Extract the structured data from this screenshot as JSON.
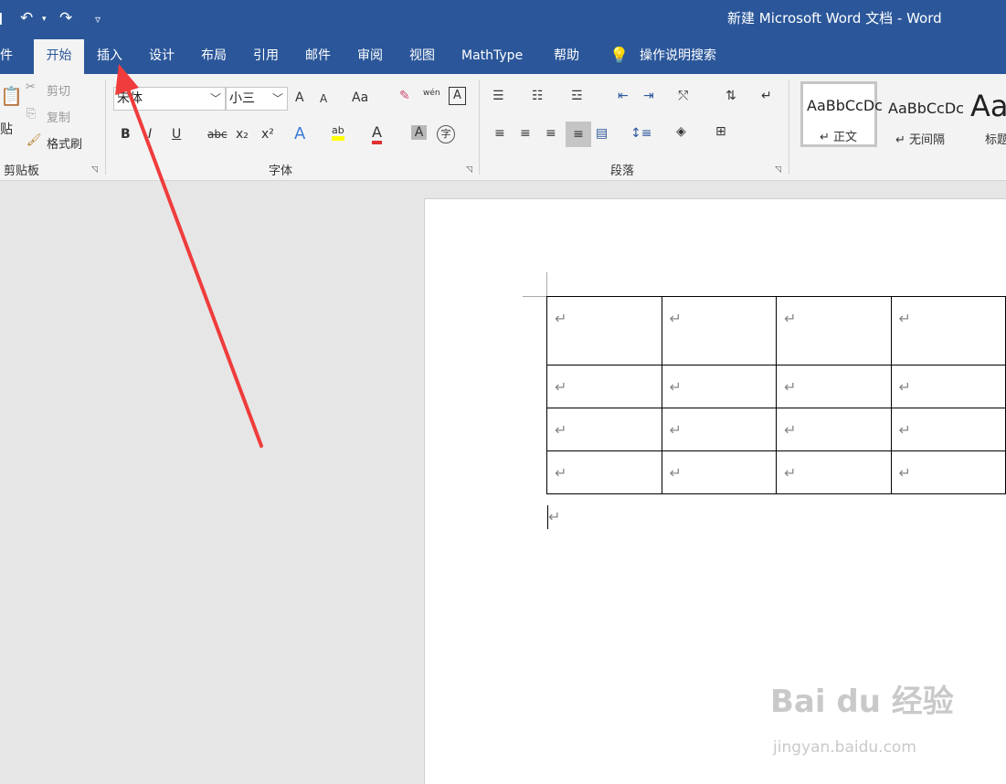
{
  "titlebar": {
    "doc_title": "新建 Microsoft Word 文档  -  Word",
    "save_icon": "save-icon",
    "undo_icon": "undo-icon",
    "redo_icon": "redo-icon",
    "customize_icon": "customize-qat-icon"
  },
  "tabs": [
    {
      "label": "件"
    },
    {
      "label": "开始"
    },
    {
      "label": "插入"
    },
    {
      "label": "设计"
    },
    {
      "label": "布局"
    },
    {
      "label": "引用"
    },
    {
      "label": "邮件"
    },
    {
      "label": "审阅"
    },
    {
      "label": "视图"
    },
    {
      "label": "MathType"
    },
    {
      "label": "帮助"
    },
    {
      "label": "操作说明搜索"
    }
  ],
  "clipboard": {
    "paste": "贴",
    "cut": "剪切",
    "copy": "复制",
    "format_painter": "格式刷",
    "group_label": "剪贴板"
  },
  "font": {
    "font_name": "宋体",
    "font_size": "小三",
    "grow": "A",
    "shrink": "A",
    "change_case": "Aa",
    "bold": "B",
    "italic": "I",
    "underline": "U",
    "strikethrough": "abc",
    "subscript": "x₂",
    "superscript": "x²",
    "highlight": "ab",
    "font_color": "A",
    "char_shading": "A",
    "enclose_char": "字",
    "phonetic": "wén",
    "group_label": "字体"
  },
  "paragraph": {
    "group_label": "段落"
  },
  "styles": {
    "items": [
      {
        "sample": "AaBbCcDc",
        "name": "↵ 正文"
      },
      {
        "sample": "AaBbCcDc",
        "name": "↵ 无间隔"
      },
      {
        "sample": "Aa",
        "name": "标题"
      }
    ]
  },
  "document": {
    "table": {
      "rows": [
        [
          "↵",
          "↵",
          "↵",
          "↵"
        ],
        [
          "↵",
          "↵",
          "↵",
          "↵"
        ],
        [
          "↵",
          "↵",
          "↵",
          "↵"
        ],
        [
          "↵",
          "↵",
          "↵",
          "↵"
        ]
      ]
    },
    "after_table_mark": "↵"
  },
  "watermark": {
    "brand": "Bai du 经验",
    "url": "jingyan.baidu.com"
  },
  "colors": {
    "title_bar": "#2b579a",
    "ribbon": "#f3f3f3",
    "annotation_arrow": "#f03c3c",
    "highlight": "#ffff00",
    "font_color": "#e03030"
  }
}
